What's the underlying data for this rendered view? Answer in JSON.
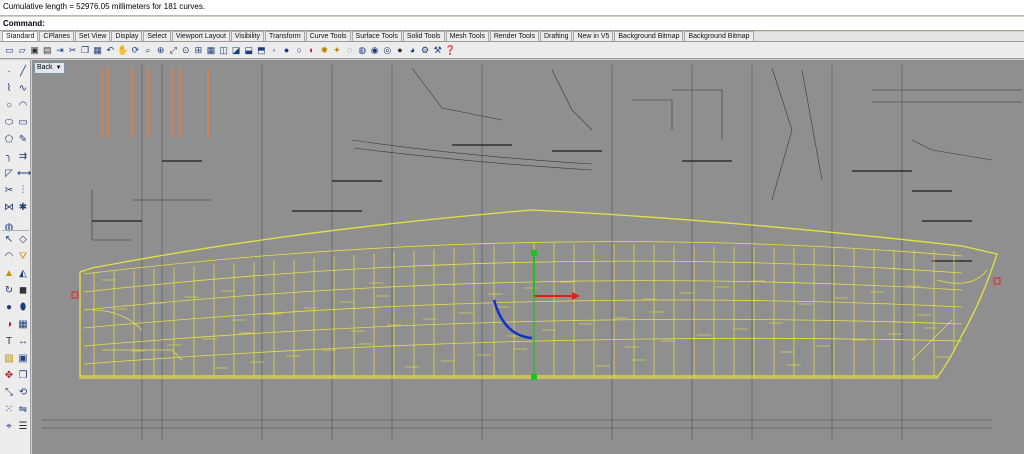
{
  "history": {
    "text": "Cumulative length = 52976.05 millimeters for 181 curves."
  },
  "command": {
    "label": "Command:",
    "value": ""
  },
  "tabs": [
    {
      "label": "Standard",
      "active": true
    },
    {
      "label": "CPlanes"
    },
    {
      "label": "Set View"
    },
    {
      "label": "Display"
    },
    {
      "label": "Select"
    },
    {
      "label": "Viewport Layout"
    },
    {
      "label": "Visibility"
    },
    {
      "label": "Transform"
    },
    {
      "label": "Curve Tools"
    },
    {
      "label": "Surface Tools"
    },
    {
      "label": "Solid Tools"
    },
    {
      "label": "Mesh Tools"
    },
    {
      "label": "Render Tools"
    },
    {
      "label": "Drafting"
    },
    {
      "label": "New in V5"
    },
    {
      "label": "Background Bitmap"
    },
    {
      "label": "Background Bitmap"
    }
  ],
  "toolbar_icons": [
    "new-file-icon",
    "open-file-icon",
    "save-icon",
    "print-icon",
    "import-icon",
    "cut-icon",
    "copy-icon",
    "paste-icon",
    "undo-icon",
    "pan-hand-icon",
    "rotate-view-icon",
    "zoom-dynamic-icon",
    "zoom-window-icon",
    "zoom-extents-icon",
    "zoom-selected-icon",
    "four-views-icon",
    "grid-icon",
    "named-views-icon",
    "cplane-icon",
    "car-icon",
    "lock-icon",
    "point-off-icon",
    "hide-icon",
    "show-icon",
    "color-icon",
    "bulb-icon",
    "light-icon",
    "wireframe-icon",
    "shaded-icon",
    "render-icon",
    "material-icon",
    "rendered-sphere-icon",
    "texture-sphere-icon",
    "options-icon",
    "toolbar-options-icon",
    "help-icon"
  ],
  "sidebar_icons": [
    "point-icon",
    "line-icon",
    "polyline-icon",
    "curve-icon",
    "circle-icon",
    "arc-icon",
    "ellipse-icon",
    "rectangle-icon",
    "polygon-icon",
    "freeform-icon",
    "fillet-icon",
    "offset-icon",
    "chamfer-icon",
    "extend-icon",
    "trim-icon",
    "split-icon",
    "join-icon",
    "explode-icon",
    "globe-icon",
    "select-arrow-icon",
    "plane-icon",
    "surface-curve-icon",
    "loft-icon",
    "extrude-icon",
    "sweep-icon",
    "revolve-icon",
    "box-icon",
    "sphere-icon",
    "cylinder-icon",
    "boolean-icon",
    "mesh-icon",
    "text-icon",
    "dimension-icon",
    "hatch-icon",
    "block-icon",
    "move-icon",
    "copy-object-icon",
    "scale-icon",
    "rotate-object-icon",
    "array-icon",
    "mirror-icon",
    "analyze-icon",
    "properties-icon"
  ],
  "viewport": {
    "name": "Back"
  },
  "colors": {
    "viewport_bg": "#8e8e8e",
    "curve_yellow": "#e8e040",
    "gumball_x": "#e02020",
    "gumball_y": "#20c020",
    "gumball_arc": "#1030d0",
    "orange_lines": "#e08040"
  }
}
